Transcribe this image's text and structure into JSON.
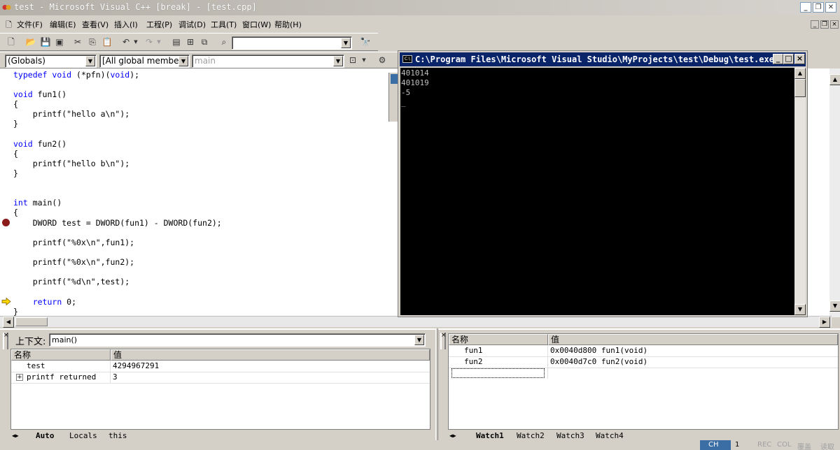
{
  "window": {
    "title": "test - Microsoft Visual C++ [break] - [test.cpp]",
    "minimize_glyph": "_",
    "restore_glyph": "❐",
    "close_glyph": "✕"
  },
  "menu": [
    "文件(F)",
    "编辑(E)",
    "查看(V)",
    "插入(I)",
    "工程(P)",
    "调试(D)",
    "工具(T)",
    "窗口(W)",
    "帮助(H)"
  ],
  "wizardbar": {
    "scope": "(Globals)",
    "members": "[All global members",
    "function": "main"
  },
  "code_lines": [
    {
      "parts": [
        [
          "kw",
          "typedef"
        ],
        [
          "t",
          " "
        ],
        [
          "kw",
          "void"
        ],
        [
          "t",
          " (*pfn)("
        ],
        [
          "kw",
          "void"
        ],
        [
          "t",
          ");"
        ]
      ]
    },
    {
      "parts": [
        [
          "kw",
          "void"
        ],
        [
          "t",
          " fun1()"
        ]
      ]
    },
    {
      "parts": [
        [
          "t",
          "{"
        ]
      ]
    },
    {
      "parts": [
        [
          "t",
          "    printf(\"hello a\\n\");"
        ]
      ]
    },
    {
      "parts": [
        [
          "t",
          "}"
        ]
      ]
    },
    {
      "parts": [
        [
          "kw",
          "void"
        ],
        [
          "t",
          " fun2()"
        ]
      ]
    },
    {
      "parts": [
        [
          "t",
          "{"
        ]
      ]
    },
    {
      "parts": [
        [
          "t",
          "    printf(\"hello b\\n\");"
        ]
      ]
    },
    {
      "parts": [
        [
          "t",
          "}"
        ]
      ]
    },
    {
      "parts": [
        [
          "kw",
          "int"
        ],
        [
          "t",
          " main()"
        ]
      ]
    },
    {
      "parts": [
        [
          "t",
          "{"
        ]
      ]
    },
    {
      "parts": [
        [
          "t",
          "    DWORD test = DWORD(fun1) - DWORD(fun2);"
        ]
      ]
    },
    {
      "parts": [
        [
          "t",
          "    printf(\"%0x\\n\",fun1);"
        ]
      ]
    },
    {
      "parts": [
        [
          "t",
          "    printf(\"%0x\\n\",fun2);"
        ]
      ]
    },
    {
      "parts": [
        [
          "t",
          "    printf(\"%d\\n\",test);"
        ]
      ]
    },
    {
      "parts": [
        [
          "t",
          "    "
        ],
        [
          "kw",
          "return"
        ],
        [
          "t",
          " 0;"
        ]
      ]
    },
    {
      "parts": [
        [
          "t",
          "}"
        ]
      ]
    }
  ],
  "console": {
    "title": "C:\\Program Files\\Microsoft Visual Studio\\MyProjects\\test\\Debug\\test.exe",
    "icon_text": "C:\\",
    "lines": [
      "401014",
      "401019",
      "-5",
      "_"
    ]
  },
  "variables_pane": {
    "context_label": "上下文:",
    "context_value": "main()",
    "col_name": "名称",
    "col_value": "值",
    "rows": [
      {
        "expand": "",
        "name": "test",
        "value": "4294967291"
      },
      {
        "expand": "+",
        "name": "printf returned",
        "value": "3"
      }
    ],
    "tabs": [
      "Auto",
      "Locals",
      "this"
    ]
  },
  "watch_pane": {
    "col_name": "名称",
    "col_value": "值",
    "rows": [
      {
        "name": "fun1",
        "value": "0x0040d800 fun1(void)"
      },
      {
        "name": "fun2",
        "value": "0x0040d7c0 fun2(void)"
      }
    ],
    "tabs": [
      "Watch1",
      "Watch2",
      "Watch3",
      "Watch4"
    ]
  },
  "statusbar": {
    "ime": "CH",
    "ime_extra": "1",
    "rec": "REC",
    "col": "COL",
    "ovr": "覆盖",
    "read": "读取"
  },
  "colors": {
    "keyword": "#0000ff",
    "breakpoint": "#8b1a1a",
    "current_line_arrow": "#ffd700",
    "console_title_bg": "#0a246a",
    "console_bg": "#000000"
  }
}
